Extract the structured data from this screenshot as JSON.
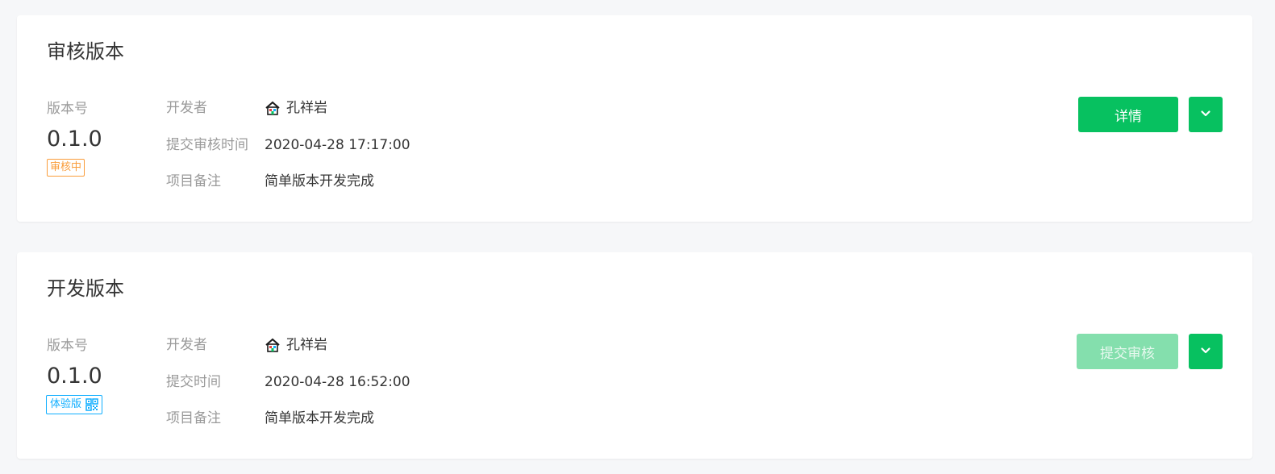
{
  "review_card": {
    "title": "审核版本",
    "version_label": "版本号",
    "version_number": "0.1.0",
    "status_tag": "审核中",
    "rows": [
      {
        "label": "开发者",
        "value": "孔祥岩"
      },
      {
        "label": "提交审核时间",
        "value": "2020-04-28 17:17:00"
      },
      {
        "label": "项目备注",
        "value": "简单版本开发完成"
      }
    ],
    "action_label": "详情"
  },
  "dev_card": {
    "title": "开发版本",
    "version_label": "版本号",
    "version_number": "0.1.0",
    "status_tag": "体验版",
    "rows": [
      {
        "label": "开发者",
        "value": "孔祥岩"
      },
      {
        "label": "提交时间",
        "value": "2020-04-28 16:52:00"
      },
      {
        "label": "项目备注",
        "value": "简单版本开发完成"
      }
    ],
    "action_label": "提交审核"
  },
  "colors": {
    "primary": "#07c160",
    "primary_disabled": "#84dfad",
    "review_tag": "#fa9d3b",
    "experience_tag": "#10aeff"
  },
  "icons": {
    "avatar": "house-avatar-icon",
    "qr": "qrcode-icon",
    "dropdown": "chevron-down-icon"
  }
}
